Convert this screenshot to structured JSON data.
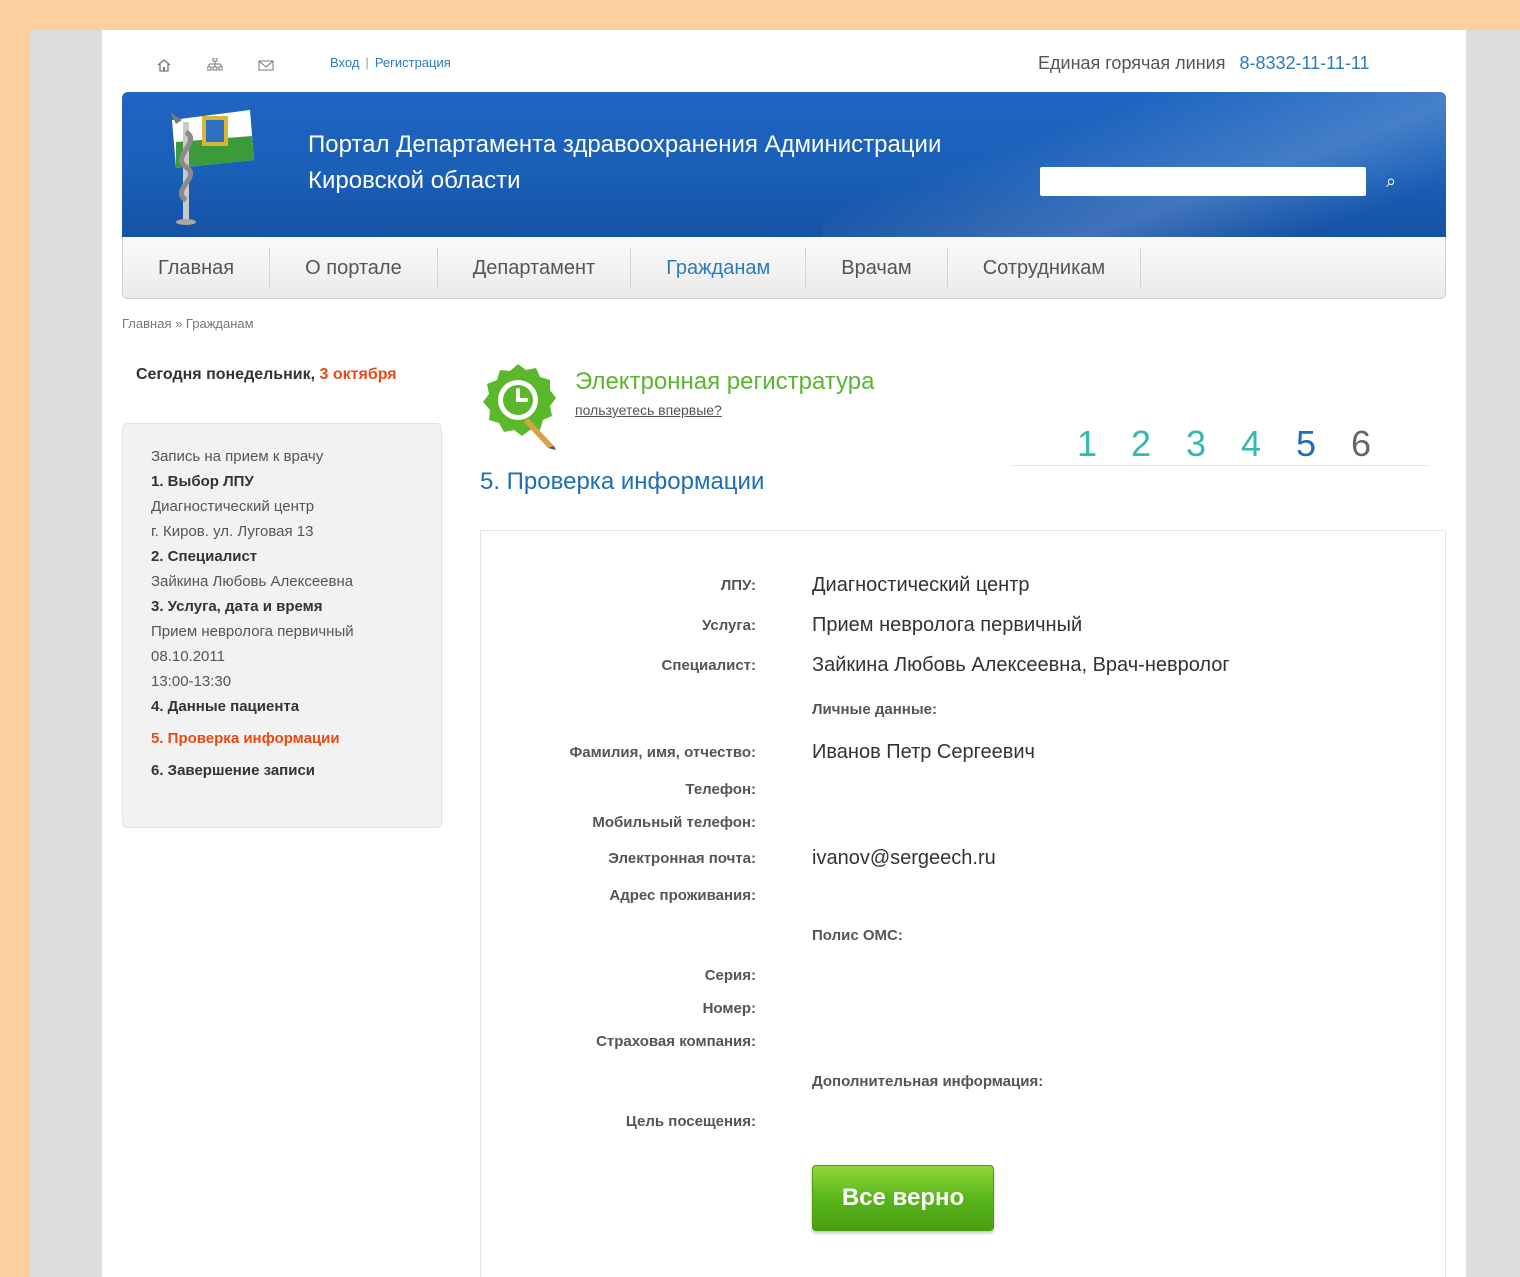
{
  "top_bar": {
    "login": "Вход",
    "register": "Регистрация",
    "separator": "|",
    "hotline_label": "Единая горячая линия",
    "hotline_phone": "8-8332-11-11-11",
    "icons": [
      "home-icon",
      "sitemap-icon",
      "mail-icon"
    ]
  },
  "header": {
    "title_line1": "Портал Департамента здравоохранения Администрации",
    "title_line2": "Кировской области",
    "search_placeholder": "",
    "search_icon": "⌕"
  },
  "nav": {
    "items": [
      {
        "label": "Главная",
        "active": false
      },
      {
        "label": "О портале",
        "active": false
      },
      {
        "label": "Департамент",
        "active": false
      },
      {
        "label": "Гражданам",
        "active": true
      },
      {
        "label": "Врачам",
        "active": false
      },
      {
        "label": "Сотрудникам",
        "active": false
      }
    ]
  },
  "breadcrumb": "Главная » Гражданам",
  "today": {
    "prefix": "Сегодня понедельник, ",
    "date": "3 октября"
  },
  "sidebar": {
    "intro": "Запись на прием к врачу",
    "step1": "1. Выбор ЛПУ",
    "step1_detail_a": "Диагностический центр",
    "step1_detail_b": "г. Киров. ул. Луговая 13",
    "step2": "2. Специалист",
    "step2_detail": "Зайкина Любовь Алексеевна",
    "step3": "3. Услуга, дата и время",
    "step3_detail_a": "Прием невролога первичный",
    "step3_detail_b": "08.10.2011",
    "step3_detail_c": "13:00-13:30",
    "step4": "4. Данные пациента",
    "step5": "5. Проверка информации",
    "step6": "6. Завершение записи"
  },
  "ereg": {
    "title": "Электронная регистратура",
    "first_time": "пользуетесь впервые?"
  },
  "steps_progress": {
    "numbers": [
      "1",
      "2",
      "3",
      "4",
      "5",
      "6"
    ],
    "current": 5,
    "colors": {
      "done": "#35b8ad",
      "current": "#1d6db7",
      "todo": "#666666"
    }
  },
  "section_title": "5. Проверка информации",
  "info": {
    "lpu_label": "ЛПУ:",
    "lpu_value": "Диагностический центр",
    "service_label": "Услуга:",
    "service_value": "Прием невролога первичный",
    "specialist_label": "Специалист:",
    "specialist_value": "Зайкина Любовь Алексеевна, Врач-невролог",
    "personal_heading": "Личные данные:",
    "fio_label": "Фамилия, имя, отчество:",
    "fio_value": "Иванов Петр Сергеевич",
    "phone_label": "Телефон:",
    "mobile_label": "Мобильный телефон:",
    "email_label": "Электронная почта:",
    "email_value": "ivanov@sergeech.ru",
    "address_label": "Адрес проживания:",
    "oms_heading": "Полис ОМС:",
    "series_label": "Серия:",
    "number_label": "Номер:",
    "insurer_label": "Страховая компания:",
    "extra_heading": "Дополнительная информация:",
    "purpose_label": "Цель посещения:"
  },
  "confirm_button": "Все верно"
}
